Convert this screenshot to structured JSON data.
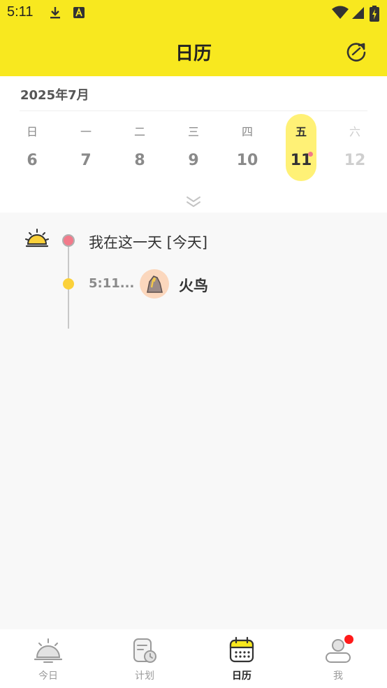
{
  "status_bar": {
    "time": "5:11",
    "icons": [
      "download-icon",
      "text-a-icon",
      "wifi-icon",
      "signal-icon",
      "battery-charging-icon"
    ]
  },
  "header": {
    "title": "日历",
    "action_icon": "refresh-icon"
  },
  "calendar": {
    "month_label": "2025年7月",
    "days": [
      {
        "weekday": "日",
        "day": "6"
      },
      {
        "weekday": "一",
        "day": "7"
      },
      {
        "weekday": "二",
        "day": "8"
      },
      {
        "weekday": "三",
        "day": "9"
      },
      {
        "weekday": "四",
        "day": "10"
      },
      {
        "weekday": "五",
        "day": "11",
        "selected": true,
        "has_event": true
      },
      {
        "weekday": "六",
        "day": "12",
        "faded": true
      }
    ],
    "expand_icon": "double-chevron-down-icon"
  },
  "timeline": {
    "header_icon": "sunrise-icon",
    "day_title": "我在这一天 [今天]",
    "entries": [
      {
        "time": "5:11...",
        "name": "火鸟",
        "avatar_icon": "firebird-avatar"
      }
    ]
  },
  "bottom_nav": {
    "items": [
      {
        "label": "今日",
        "icon": "sunrise-icon"
      },
      {
        "label": "计划",
        "icon": "plan-clock-icon"
      },
      {
        "label": "日历",
        "icon": "calendar-icon",
        "active": true
      },
      {
        "label": "我",
        "icon": "profile-icon",
        "has_notification": true
      }
    ]
  },
  "colors": {
    "accent_yellow": "#f8e81f",
    "selected_day": "#fff176",
    "pink_dot": "#f27a8a",
    "yellow_dot": "#fbd13a",
    "notification": "#ff1a1a"
  }
}
